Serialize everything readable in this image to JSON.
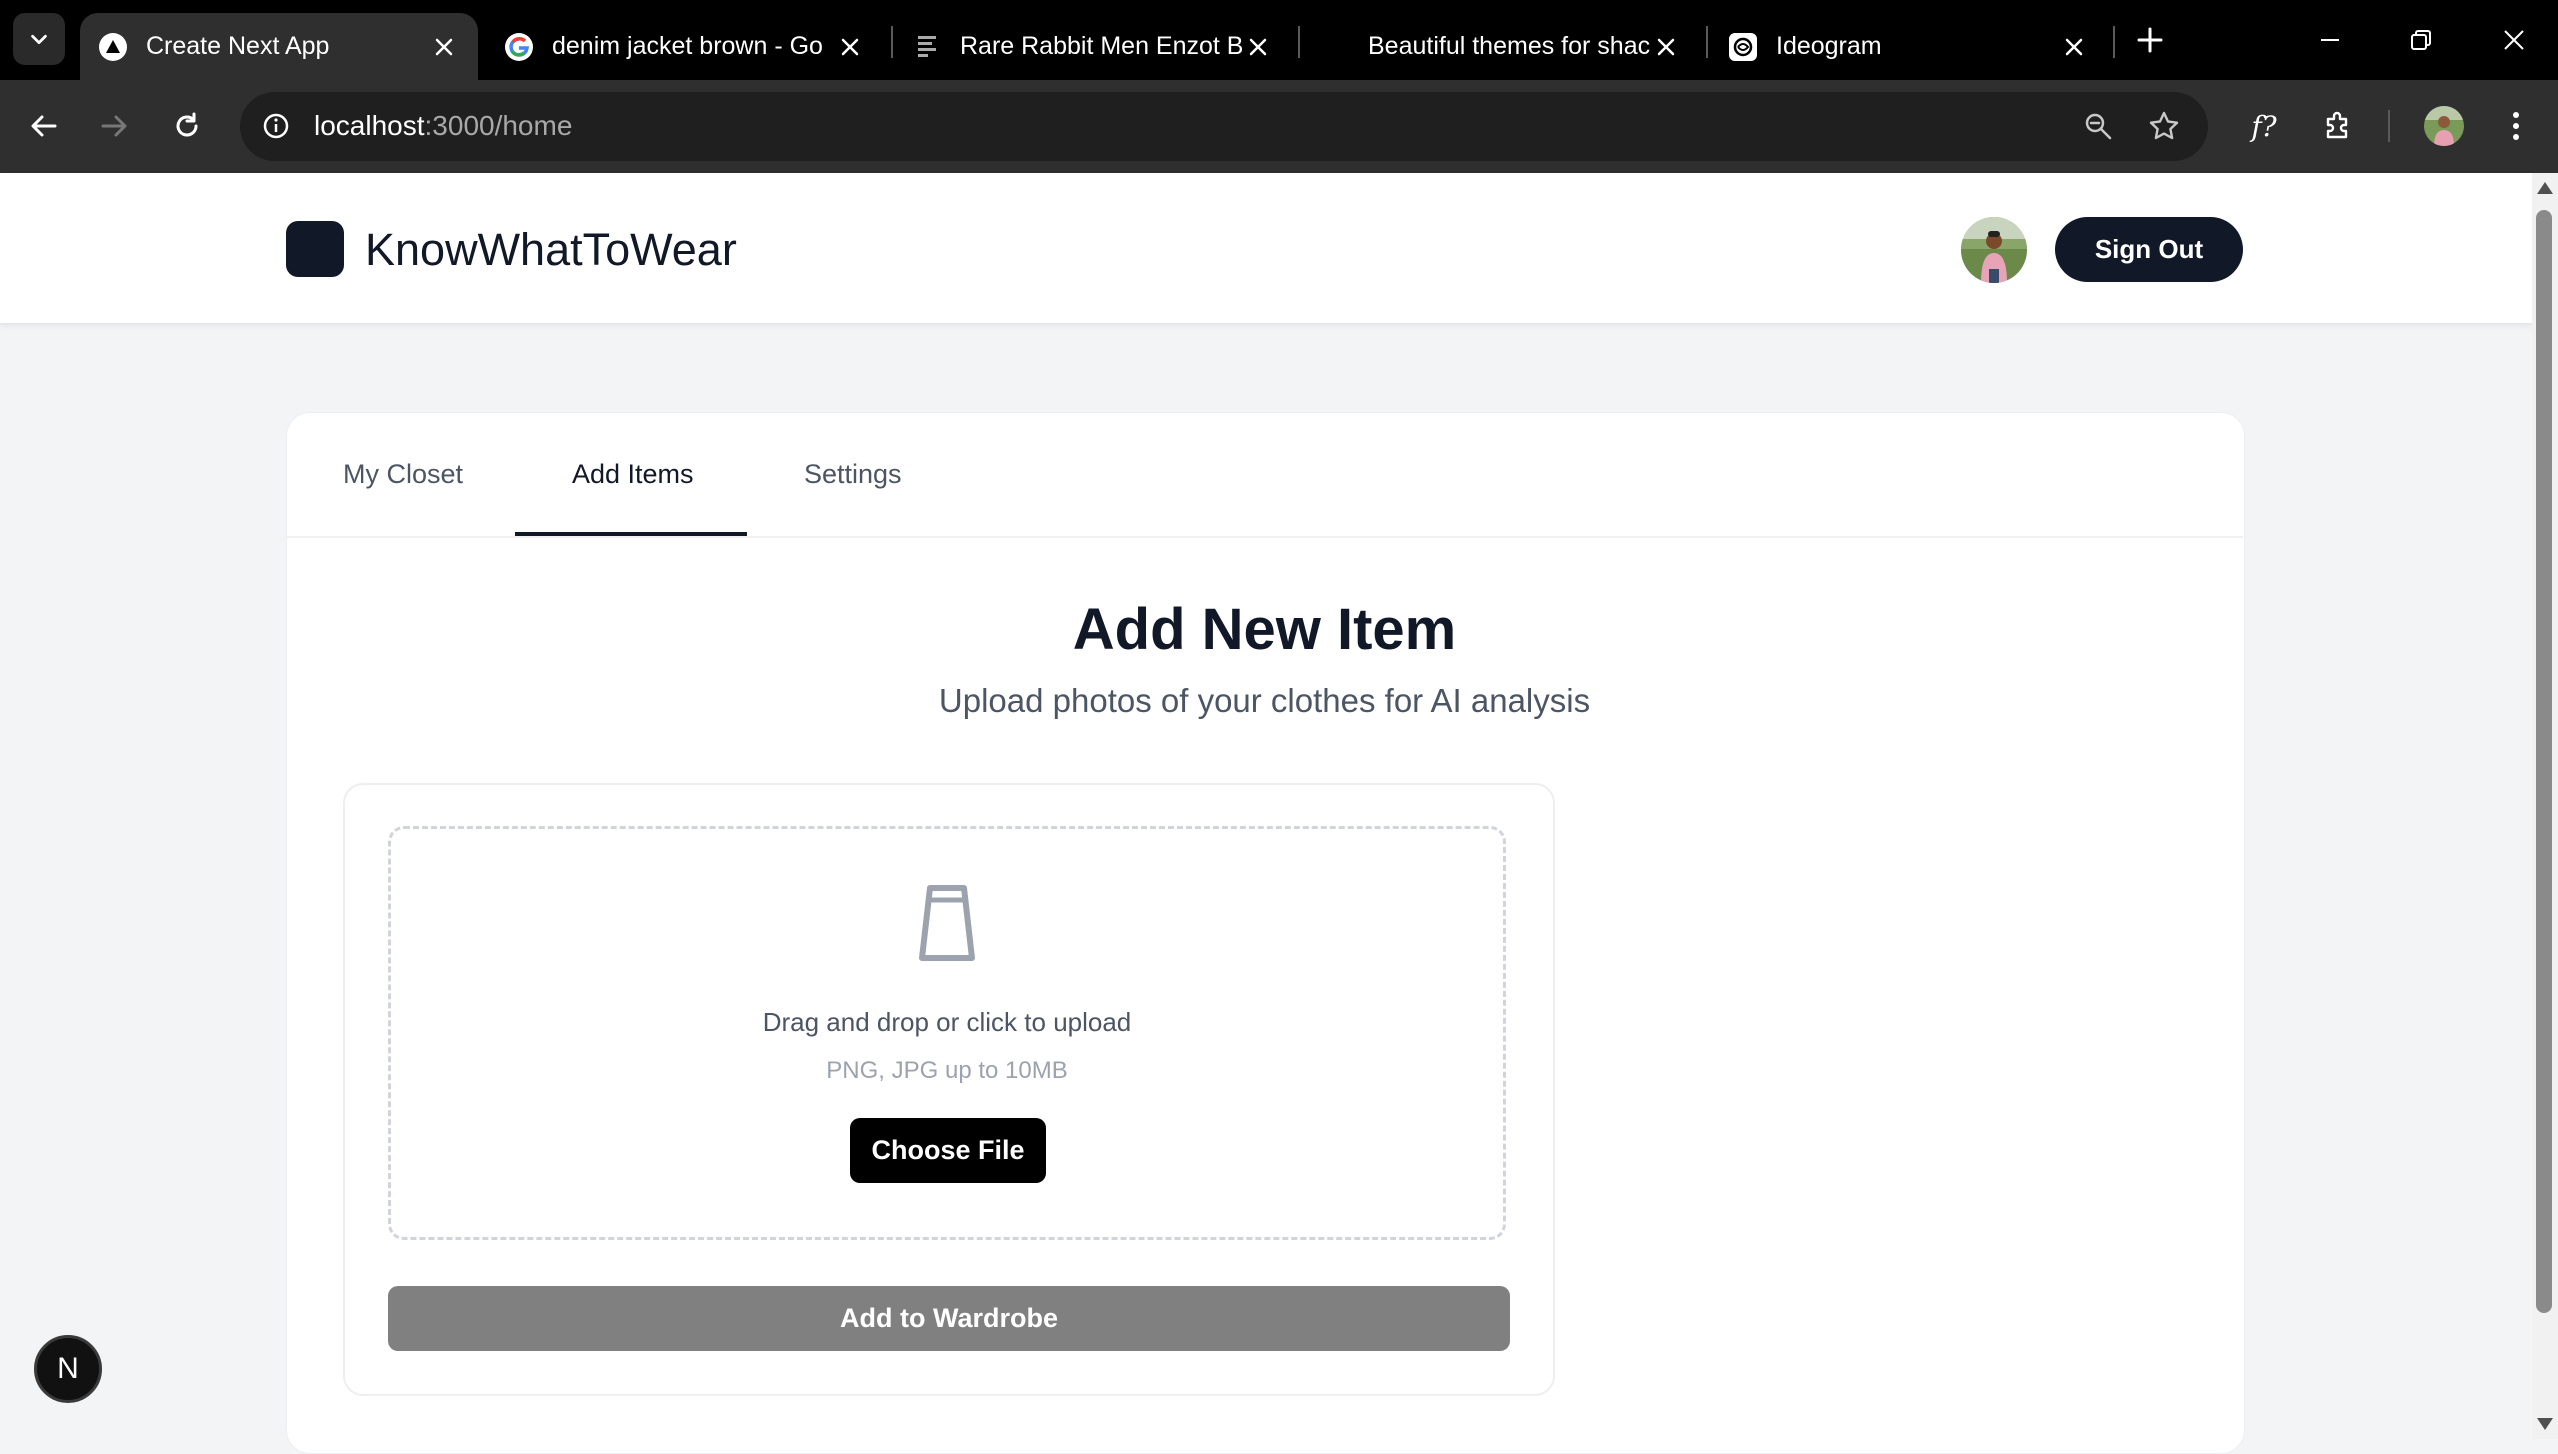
{
  "browser": {
    "tabs": [
      {
        "title": "Create Next App",
        "icon": "vercel-triangle-icon",
        "active": true
      },
      {
        "title": "denim jacket brown - Go",
        "icon": "google-icon",
        "active": false
      },
      {
        "title": "Rare Rabbit Men Enzot B",
        "icon": "house-of-rare-icon",
        "active": false
      },
      {
        "title": "Beautiful themes for shac",
        "icon": "blank-icon",
        "active": false
      },
      {
        "title": "Ideogram",
        "icon": "ideogram-icon",
        "active": false
      }
    ],
    "url_host": "localhost",
    "url_path": ":3000/home",
    "icons": {
      "tab_search": "chevron-down-icon",
      "new_tab": "plus-icon",
      "minimize": "minimize-icon",
      "restore": "restore-icon",
      "close": "close-icon",
      "back": "arrow-left-icon",
      "forward": "arrow-right-icon",
      "reload": "reload-icon",
      "site_info": "info-icon",
      "zoom": "zoom-out-icon",
      "bookmark": "star-icon",
      "font": "font-icon",
      "extensions": "puzzle-icon",
      "menu": "kebab-menu-icon"
    }
  },
  "header": {
    "brand": "KnowWhatToWear",
    "sign_out": "Sign Out"
  },
  "tabs": {
    "items": [
      {
        "label": "My Closet",
        "active": false
      },
      {
        "label": "Add Items",
        "active": true
      },
      {
        "label": "Settings",
        "active": false
      }
    ]
  },
  "main": {
    "title": "Add New Item",
    "subtitle": "Upload photos of your clothes for AI analysis",
    "dropzone_text": "Drag and drop or click to upload",
    "dropzone_hint": "PNG, JPG up to 10MB",
    "choose_file": "Choose File",
    "add_to_wardrobe": "Add to Wardrobe"
  },
  "badge": {
    "letter": "N"
  },
  "colors": {
    "primary": "#111827",
    "page_bg": "#f3f4f6",
    "disabled_button": "#808080"
  }
}
